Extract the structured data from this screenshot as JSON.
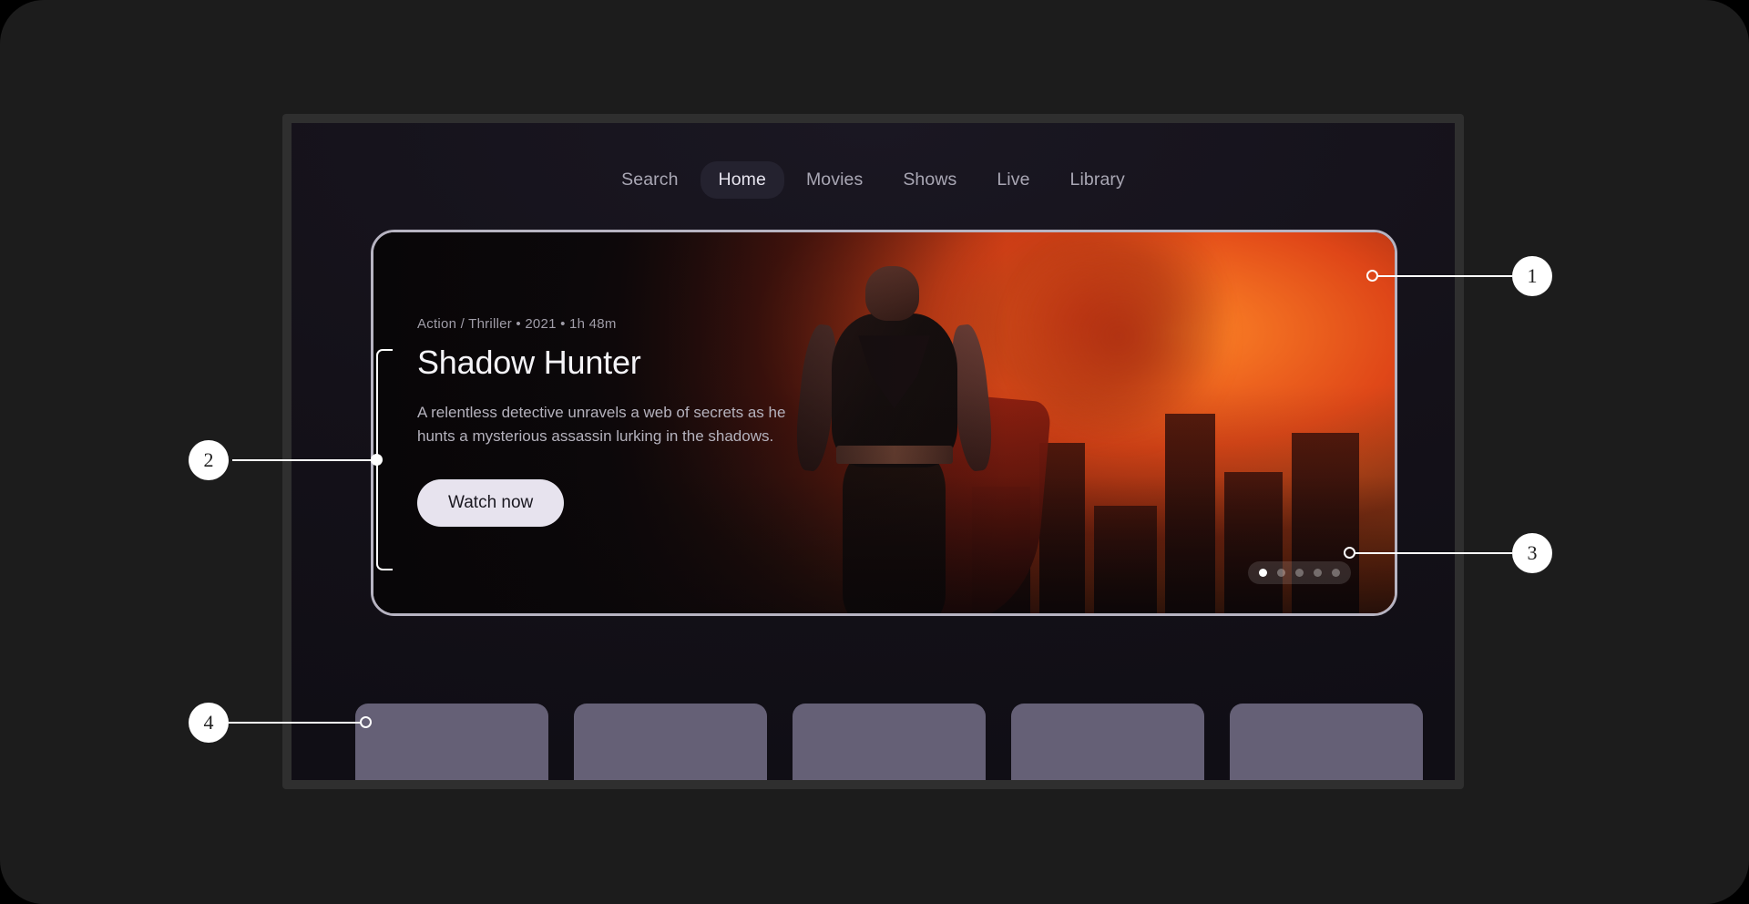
{
  "device": {
    "name": "tv-device"
  },
  "nav": {
    "items": [
      {
        "label": "Search",
        "active": false
      },
      {
        "label": "Home",
        "active": true
      },
      {
        "label": "Movies",
        "active": false
      },
      {
        "label": "Shows",
        "active": false
      },
      {
        "label": "Live",
        "active": false
      },
      {
        "label": "Library",
        "active": false
      }
    ]
  },
  "hero": {
    "meta": "Action / Thriller  •  2021  •  1h 48m",
    "title": "Shadow Hunter",
    "description": "A relentless detective unravels a web of secrets as he hunts a mysterious assassin lurking in the shadows.",
    "button_label": "Watch now",
    "artwork_alt": "hero-artwork-superhero-burning-city",
    "border_color": "#b7b4c2"
  },
  "carousel": {
    "total": 5,
    "active_index": 0
  },
  "thumbnails": {
    "count": 5,
    "color": "#656076"
  },
  "annotations": [
    {
      "id": "1",
      "number": "1",
      "target": "hero-card-border"
    },
    {
      "id": "2",
      "number": "2",
      "target": "hero-content-block"
    },
    {
      "id": "3",
      "number": "3",
      "target": "carousel-dots"
    },
    {
      "id": "4",
      "number": "4",
      "target": "thumbnail-row"
    }
  ],
  "colors": {
    "page_background": "#1c1c1c",
    "bezel": "#2f2f2f",
    "screen": "#141119",
    "accent_button": "#e7e3ee",
    "nav_active_pill": "#24222f"
  }
}
